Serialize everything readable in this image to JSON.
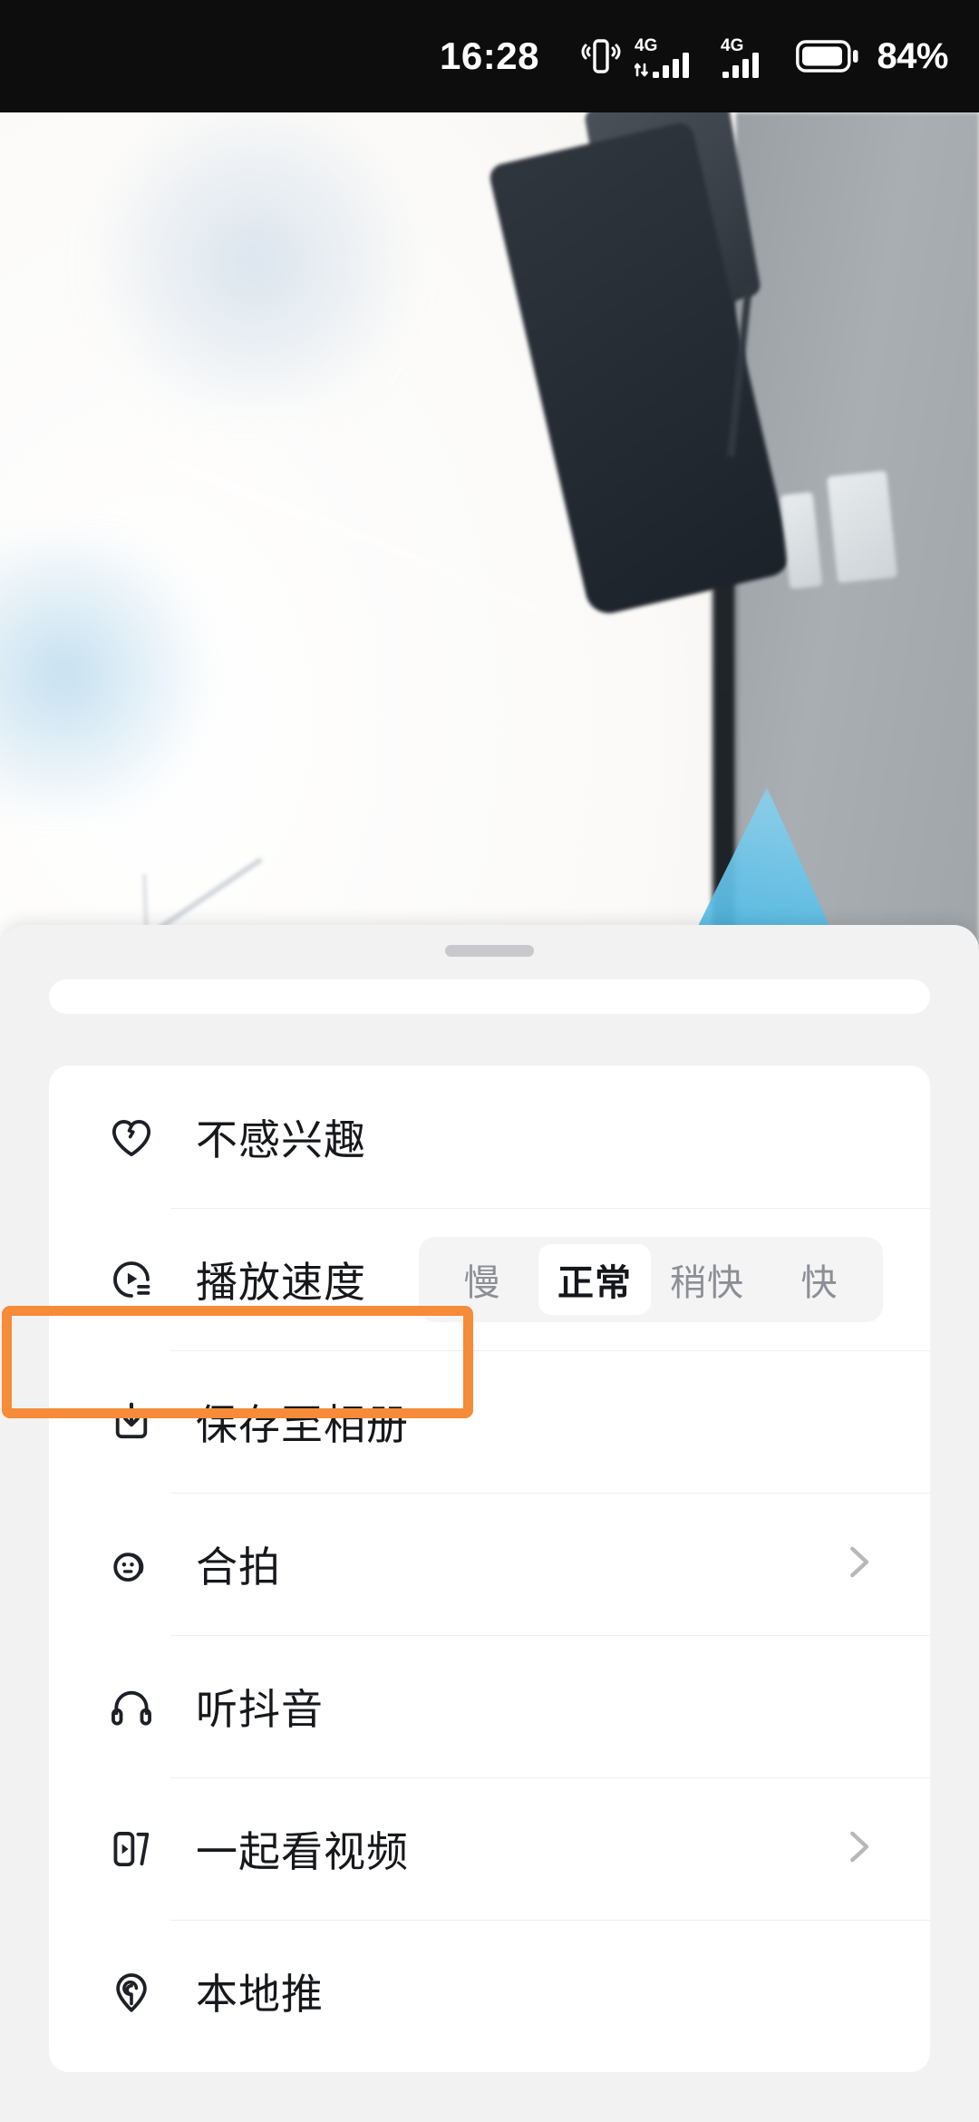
{
  "status_bar": {
    "time": "16:28",
    "battery_percent": "84%",
    "icons": [
      "vibrate-icon",
      "signal-4g-primary-icon",
      "signal-4g-secondary-icon",
      "battery-icon"
    ],
    "network_label_1": "4G",
    "network_label_2": "4G"
  },
  "sheet": {
    "handle": "drag-handle",
    "options": [
      {
        "id": "not-interested",
        "label": "不感兴趣",
        "icon": "broken-heart-icon",
        "chevron": false,
        "highlighted": false
      },
      {
        "id": "playback-speed",
        "label": "播放速度",
        "icon": "playback-speed-icon",
        "chevron": false,
        "highlighted": false,
        "speed_options": [
          {
            "label": "慢",
            "selected": false
          },
          {
            "label": "正常",
            "selected": true
          },
          {
            "label": "稍快",
            "selected": false
          },
          {
            "label": "快",
            "selected": false
          }
        ]
      },
      {
        "id": "save-to-album",
        "label": "保存至相册",
        "icon": "download-icon",
        "chevron": false,
        "highlighted": true
      },
      {
        "id": "duet",
        "label": "合拍",
        "icon": "duet-smiley-icon",
        "chevron": true,
        "highlighted": false
      },
      {
        "id": "listen-douyin",
        "label": "听抖音",
        "icon": "headphones-icon",
        "chevron": false,
        "highlighted": false
      },
      {
        "id": "watch-together",
        "label": "一起看视频",
        "icon": "watch-together-icon",
        "chevron": true,
        "highlighted": false
      },
      {
        "id": "local-promotion",
        "label": "本地推",
        "icon": "location-pin-icon",
        "chevron": false,
        "highlighted": false
      }
    ]
  },
  "colors": {
    "highlight": "#F68B39",
    "sheet_background": "#F2F2F2",
    "card_background": "#FFFFFF",
    "text_primary": "#16181C",
    "text_muted": "#8D8F96",
    "divider": "#EFEFEF",
    "status_bar_background": "#0D0D0D"
  }
}
